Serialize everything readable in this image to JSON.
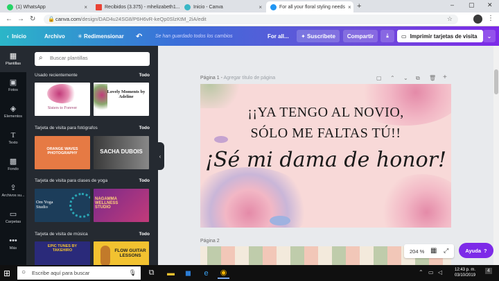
{
  "browser": {
    "tabs": [
      {
        "label": "(1) WhatsApp",
        "favicon_color": "#25d366"
      },
      {
        "label": "Recibidos (3.375) - mhelizabeth1...",
        "favicon_color": "#ea4335"
      },
      {
        "label": "Inicio - Canva",
        "favicon_color": "#3ab7c6"
      },
      {
        "label": "For all your floral styling needs",
        "favicon_color": "#2196f3"
      }
    ],
    "new_tab": "+",
    "url_host": "canva.com",
    "url_path": "/design/DAD4u24SG8/P6H6vR-keQp0SlzKtM_2iA/edit"
  },
  "toolbar": {
    "home": "Inicio",
    "file": "Archivo",
    "resize": "Redimensionar",
    "saved_status": "Se han guardado todos los cambios",
    "for_all": "For all...",
    "subscribe": "Suscríbete",
    "share": "Compartir",
    "print": "Imprimir tarjetas de visita"
  },
  "rail": [
    {
      "label": "Plantillas",
      "icon": "layout-icon"
    },
    {
      "label": "Fotos",
      "icon": "photo-icon"
    },
    {
      "label": "Elementos",
      "icon": "shapes-icon"
    },
    {
      "label": "Texto",
      "icon": "text-icon"
    },
    {
      "label": "Fondo",
      "icon": "background-icon"
    },
    {
      "label": "Archivos su...",
      "icon": "upload-icon"
    },
    {
      "label": "Carpetas",
      "icon": "folder-icon"
    },
    {
      "label": "Más",
      "icon": "more-icon"
    }
  ],
  "panel": {
    "search_placeholder": "Buscar plantillas",
    "see_all": "Todo",
    "sections": [
      {
        "title": "Usado recientemente",
        "thumbs": [
          {
            "text": "Sisters to Forever",
            "bg": "#ffffff",
            "fg": "#a04070"
          },
          {
            "text": "Lovely Moments by Adeline",
            "bg": "#ffffff",
            "fg": "#222222"
          }
        ]
      },
      {
        "title": "Tarjeta de visita para fotógrafos",
        "thumbs": [
          {
            "text": "ORANGE WAVES PHOTOGRAPHY",
            "bg": "#e67a44",
            "fg": "#ffffff"
          },
          {
            "text": "SACHA DUBOIS",
            "bg": "#555555",
            "fg": "#ffffff"
          }
        ]
      },
      {
        "title": "Tarjeta de visita para clases de yoga",
        "thumbs": [
          {
            "text": "Om Yoga Studio",
            "bg": "#1c3d5a",
            "fg": "#ffffff"
          },
          {
            "text": "NAGAMMA WELLNESS STUDIO",
            "bg": "#b0306a",
            "fg": "#ffd27a"
          }
        ]
      },
      {
        "title": "Tarjeta de visita de música",
        "thumbs": [
          {
            "text": "EPIC TUNES BY TAKEHIRO",
            "bg": "#2a2a7a",
            "fg": "#f2c230"
          },
          {
            "text": "FLOW GUITAR LESSONS",
            "bg": "#f2c230",
            "fg": "#222222"
          }
        ]
      }
    ]
  },
  "workspace": {
    "page1_label": "Página 1",
    "page1_title": "Agregar título de página",
    "page2_label": "Página 2",
    "design_lines": [
      "¡¡YA TENGO AL NOVIO,",
      "SÓLO ME FALTAS TÚ!!",
      "¡Sé mi dama de honor!"
    ],
    "zoom": "204 %",
    "help": "Ayuda",
    "help_icon": "?"
  },
  "taskbar": {
    "search_placeholder": "Escribe aquí para buscar",
    "time": "12:43 p. m.",
    "date": "03/10/2019",
    "notifications": "4"
  },
  "colors": {
    "canvas_pink": "#f8d9d8",
    "panel_bg": "#252a31",
    "accent_purple": "#7d2ae8"
  }
}
